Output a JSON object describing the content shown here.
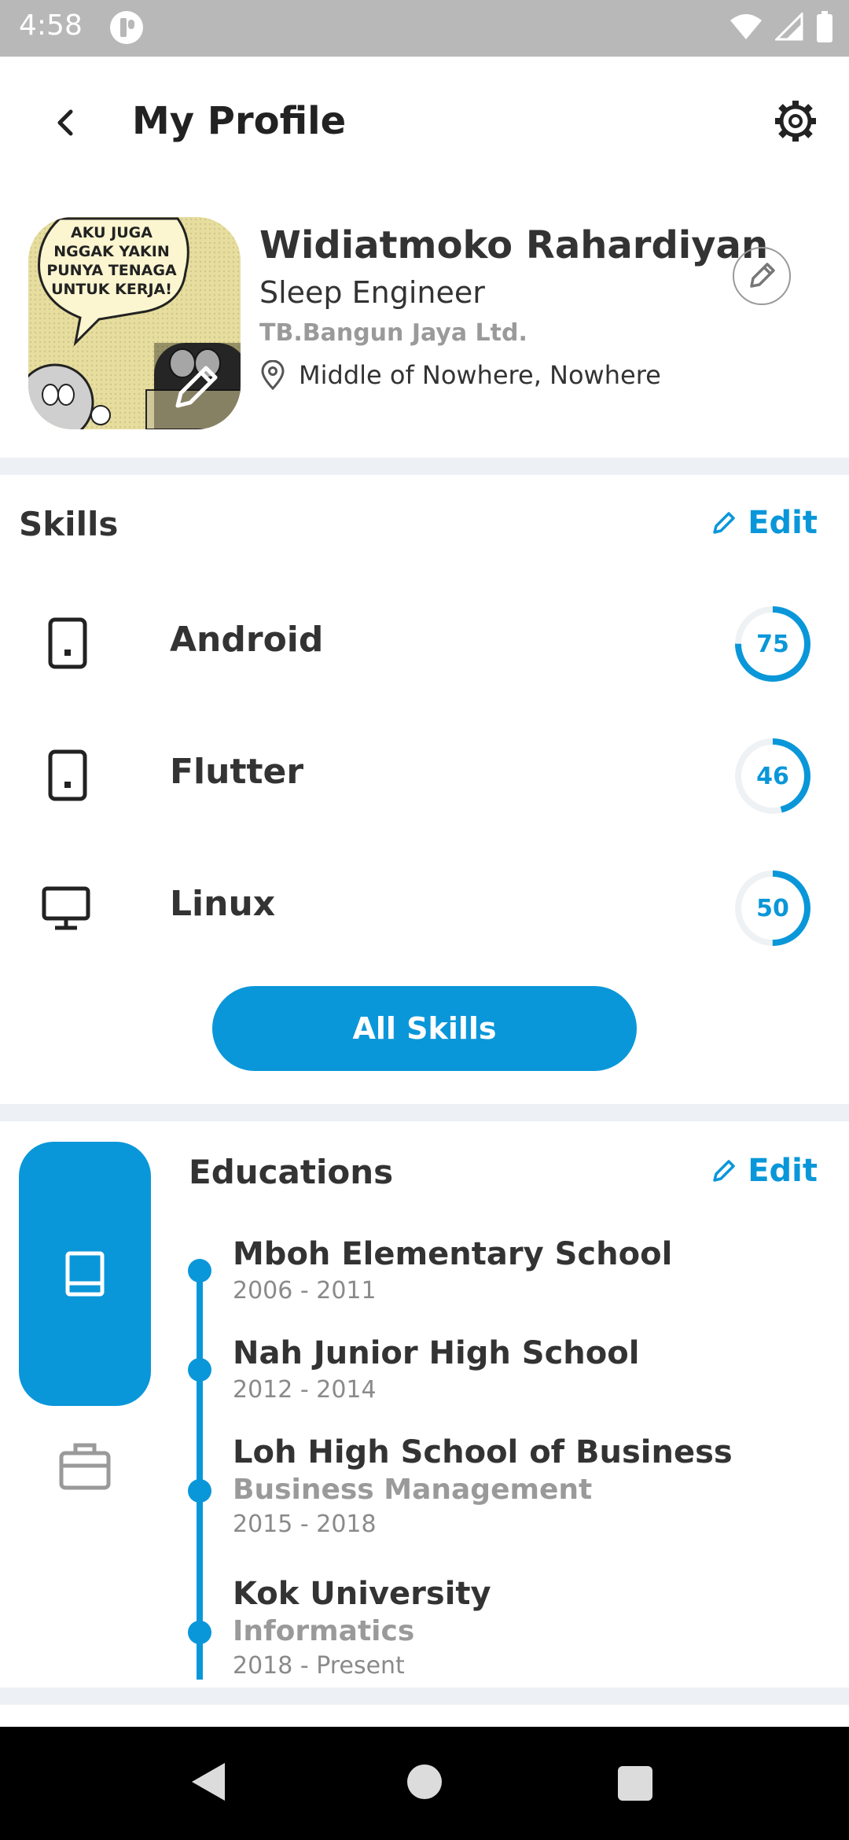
{
  "status_bar": {
    "time": "4:58",
    "icons": [
      "notification-icon",
      "wifi-icon",
      "signal-icon",
      "battery-icon"
    ]
  },
  "app_bar": {
    "title": "My Profile",
    "back_icon": "back-icon",
    "settings_icon": "gear-icon"
  },
  "profile": {
    "name": "Widiatmoko Rahardiyan",
    "job_title": "Sleep Engineer",
    "company": "TB.Bangun Jaya Ltd.",
    "location": "Middle of Nowhere, Nowhere",
    "avatar_caption": [
      "AKU JUGA",
      "NGGAK YAKIN",
      "PUNYA TENAGA",
      "UNTUK KERJA!"
    ]
  },
  "skills": {
    "title": "Skills",
    "edit_label": "Edit",
    "items": [
      {
        "name": "Android",
        "value": 75,
        "icon": "phone-icon"
      },
      {
        "name": "Flutter",
        "value": 46,
        "icon": "phone-icon"
      },
      {
        "name": "Linux",
        "value": 50,
        "icon": "desktop-icon"
      }
    ],
    "all_button": "All Skills"
  },
  "educations": {
    "title": "Educations",
    "edit_label": "Edit",
    "items": [
      {
        "school": "Mboh Elementary School",
        "major": "",
        "years": "2006 - 2011"
      },
      {
        "school": "Nah Junior High School",
        "major": "",
        "years": "2012 - 2014"
      },
      {
        "school": "Loh High School of Business",
        "major": "Business Management",
        "years": "2015 - 2018"
      },
      {
        "school": "Kok University",
        "major": "Informatics",
        "years": "2018 - Present"
      }
    ]
  },
  "colors": {
    "accent": "#0a97d9",
    "divider": "#edf1f5",
    "muted": "#9a9a9a"
  }
}
